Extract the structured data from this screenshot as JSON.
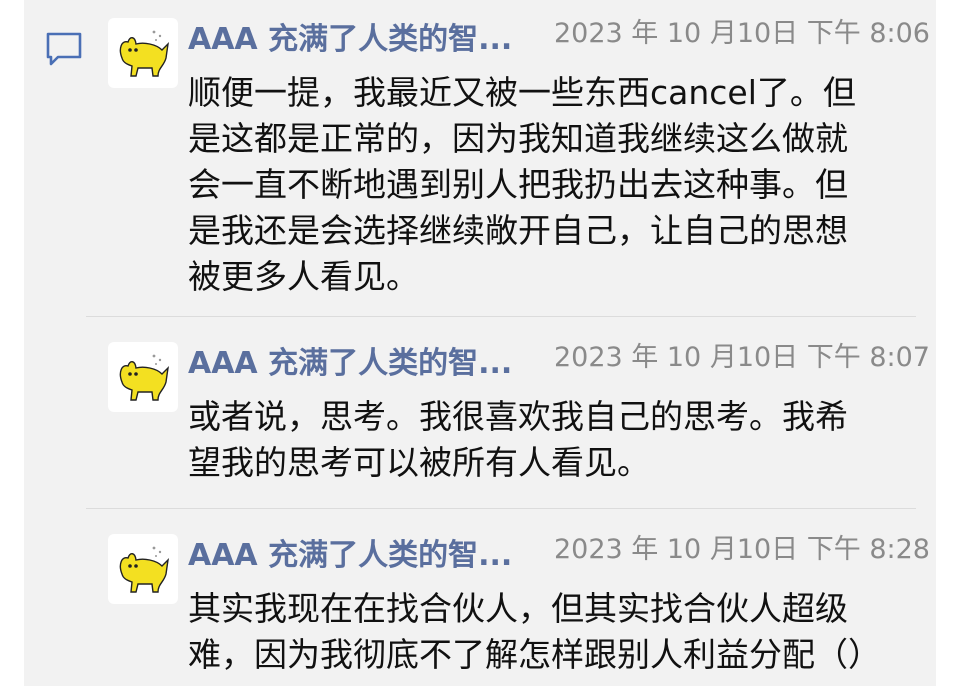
{
  "messages": [
    {
      "sender": "AAA 充满了人类的智...",
      "time": "2023 年 10 月10日 下午 8:06",
      "text": "顺便一提，我最近又被一些东西cancel了。但\n是这都是正常的，因为我知道我继续这么做就\n会一直不断地遇到别人把我扔出去这种事。但\n是我还是会选择继续敞开自己，让自己的思想\n被更多人看见。"
    },
    {
      "sender": "AAA 充满了人类的智...",
      "time": "2023 年 10 月10日 下午 8:07",
      "text": "或者说，思考。我很喜欢我自己的思考。我希\n望我的思考可以被所有人看见。"
    },
    {
      "sender": "AAA 充满了人类的智...",
      "time": "2023 年 10 月10日 下午 8:28",
      "text": "其实我现在在找合伙人，但其实找合伙人超级\n难，因为我彻底不了解怎样跟别人利益分配（）"
    }
  ],
  "icons": {
    "comment": "comment-icon",
    "avatar": "yellow-cat-avatar"
  },
  "colors": {
    "sender": "#5a6f9e",
    "time": "#8a8a8a",
    "text": "#111111",
    "panel": "#f2f2f2",
    "icon": "#4a6fb5",
    "avatar_cat": "#f3e021"
  }
}
